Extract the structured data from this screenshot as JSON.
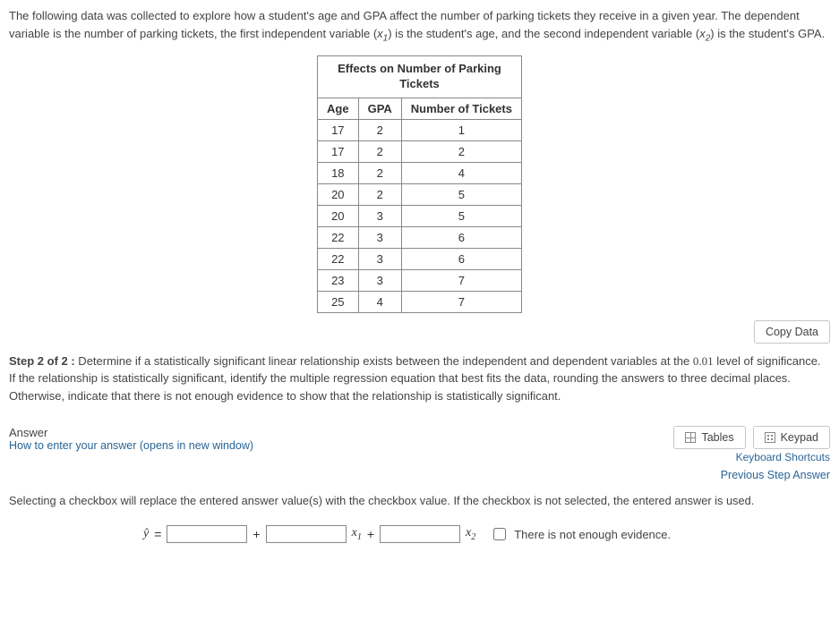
{
  "intro": {
    "text_a": "The following data was collected to explore how a student's age and GPA affect the number of parking tickets they receive in a given year. The dependent variable is the number of parking tickets, the first independent variable (",
    "var1": "x",
    "sub1": "1",
    "text_b": ") is the student's age, and the second independent variable (",
    "var2": "x",
    "sub2": "2",
    "text_c": ") is the student's GPA."
  },
  "table": {
    "caption_l1": "Effects on Number of Parking",
    "caption_l2": "Tickets",
    "headers": [
      "Age",
      "GPA",
      "Number of Tickets"
    ],
    "rows": [
      [
        "17",
        "2",
        "1"
      ],
      [
        "17",
        "2",
        "2"
      ],
      [
        "18",
        "2",
        "4"
      ],
      [
        "20",
        "2",
        "5"
      ],
      [
        "20",
        "3",
        "5"
      ],
      [
        "22",
        "3",
        "6"
      ],
      [
        "22",
        "3",
        "6"
      ],
      [
        "23",
        "3",
        "7"
      ],
      [
        "25",
        "4",
        "7"
      ]
    ]
  },
  "copy_label": "Copy Data",
  "step": {
    "label": "Step 2 of 2 :",
    "text_a": " Determine if a statistically significant linear relationship exists between the independent and dependent variables at the ",
    "sig": "0.01",
    "text_b": " level of significance. If the relationship is statistically significant, identify the multiple regression equation that best fits the data, rounding the answers to three decimal places. Otherwise, indicate that there is not enough evidence to show that the relationship is statistically significant."
  },
  "answer_section": {
    "label": "Answer",
    "how_to": "How to enter your answer (opens in new window)",
    "tables_btn": "Tables",
    "keypad_btn": "Keypad",
    "kb_shortcuts": "Keyboard Shortcuts",
    "prev_step": "Previous Step Answer",
    "help": "Selecting a checkbox will replace the entered answer value(s) with the checkbox value. If the checkbox is not selected, the entered answer is used."
  },
  "equation": {
    "yhat": "ŷ",
    "eq": "=",
    "plus1": "+",
    "x1": "x",
    "x1sub": "1",
    "plus2": "+",
    "x2": "x",
    "x2sub": "2",
    "checkbox_label": "There is not enough evidence."
  }
}
